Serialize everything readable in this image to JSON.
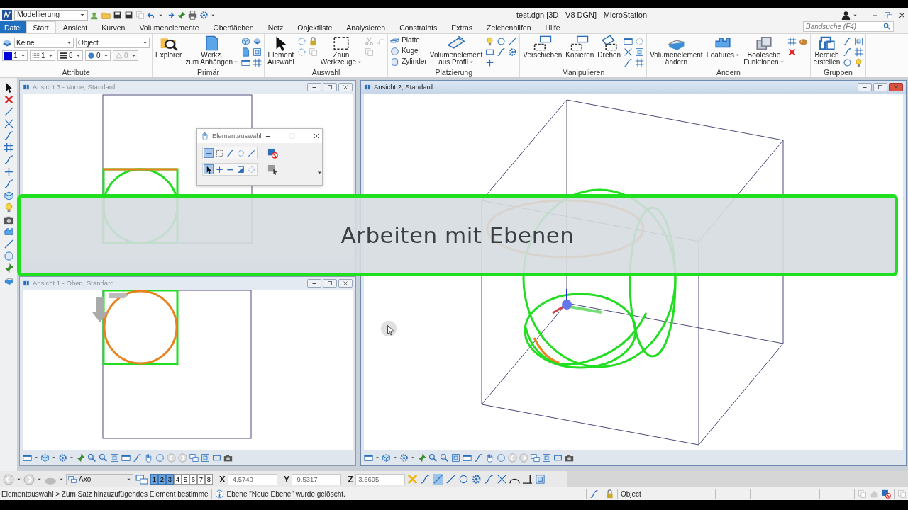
{
  "app": {
    "workflow": "Modellierung",
    "title": "test.dgn [3D - V8 DGN] - MicroStation"
  },
  "tabs": [
    {
      "label": "Datei",
      "kind": "file",
      "selected": false
    },
    {
      "label": "Start",
      "kind": "tab",
      "selected": true
    },
    {
      "label": "Ansicht",
      "kind": "tab",
      "selected": false
    },
    {
      "label": "Kurven",
      "kind": "tab",
      "selected": false
    },
    {
      "label": "Volumenelemente",
      "kind": "tab",
      "selected": false
    },
    {
      "label": "Oberflächen",
      "kind": "tab",
      "selected": false
    },
    {
      "label": "Netz",
      "kind": "tab",
      "selected": false
    },
    {
      "label": "Objektliste",
      "kind": "tab",
      "selected": false
    },
    {
      "label": "Analysieren",
      "kind": "tab",
      "selected": false
    },
    {
      "label": "Constraints",
      "kind": "tab",
      "selected": false
    },
    {
      "label": "Extras",
      "kind": "tab",
      "selected": false
    },
    {
      "label": "Zeichenhilfen",
      "kind": "tab",
      "selected": false
    },
    {
      "label": "Hilfe",
      "kind": "tab",
      "selected": false
    }
  ],
  "search": {
    "placeholder": "Bandsuche (F4)"
  },
  "attributes": {
    "label": "Attribute",
    "level": "Keine",
    "template": "Object",
    "color_index": "1",
    "line_style": "1",
    "line_weight": "8",
    "transparency": "0",
    "priority": "0",
    "priority_disabled": true
  },
  "groups": [
    {
      "label": "Primär",
      "buttons": [
        {
          "kind": "large",
          "lines": [
            "Explorer"
          ],
          "dropdown": false
        },
        {
          "kind": "large",
          "lines": [
            "Werkz.",
            "zum Anhängen"
          ],
          "dropdown": true
        },
        {
          "kind": "icons"
        }
      ]
    },
    {
      "label": "Auswahl",
      "buttons": [
        {
          "kind": "large",
          "lines": [
            "Element",
            "Auswahl"
          ],
          "dropdown": false
        },
        {
          "kind": "icons"
        },
        {
          "kind": "large",
          "lines": [
            "Zaun",
            "Werkzeuge"
          ],
          "dropdown": true
        },
        {
          "kind": "icons"
        }
      ]
    },
    {
      "label": "Platzierung",
      "buttons": [
        {
          "kind": "small",
          "lines": [
            "Platte"
          ]
        },
        {
          "kind": "small",
          "lines": [
            "Kugel"
          ]
        },
        {
          "kind": "small",
          "lines": [
            "Zylinder"
          ]
        },
        {
          "kind": "large",
          "lines": [
            "Volumenelement",
            "aus Profil"
          ],
          "dropdown": true
        },
        {
          "kind": "icons"
        }
      ]
    },
    {
      "label": "Manipulieren",
      "buttons": [
        {
          "kind": "large",
          "lines": [
            "Verschieben"
          ],
          "dropdown": false
        },
        {
          "kind": "large",
          "lines": [
            "Kopieren"
          ],
          "dropdown": false
        },
        {
          "kind": "large",
          "lines": [
            "Drehen"
          ],
          "dropdown": false
        },
        {
          "kind": "icons"
        }
      ]
    },
    {
      "label": "Ändern",
      "buttons": [
        {
          "kind": "large",
          "lines": [
            "Volumenelement",
            "ändern"
          ],
          "dropdown": false
        },
        {
          "kind": "large",
          "lines": [
            "Features"
          ],
          "dropdown": true
        },
        {
          "kind": "large",
          "lines": [
            "Boolesche",
            "Funktionen"
          ],
          "dropdown": true
        },
        {
          "kind": "icons"
        }
      ]
    },
    {
      "label": "Gruppen",
      "buttons": [
        {
          "kind": "large",
          "lines": [
            "Bereich",
            "erstellen"
          ],
          "dropdown": false
        },
        {
          "kind": "icons"
        }
      ]
    }
  ],
  "views": [
    {
      "title": "Ansicht 3 - Vorne, Standard",
      "kind": "front",
      "active": false
    },
    {
      "title": "Ansicht 1 - Oben, Standard",
      "kind": "top",
      "active": false
    },
    {
      "title": "Ansicht 2, Standard",
      "kind": "iso",
      "active": true
    }
  ],
  "selection_dialog": {
    "title": "Elementauswahl",
    "methods": [
      {
        "selected": true
      },
      {
        "selected": false
      },
      {
        "selected": false
      },
      {
        "selected": false
      },
      {
        "selected": false
      }
    ],
    "modes": [
      {
        "selected": true
      },
      {
        "selected": false
      },
      {
        "selected": false
      },
      {
        "selected": false
      },
      {
        "selected": false
      }
    ]
  },
  "overlay": {
    "text": "Arbeiten mit Ebenen"
  },
  "bottom_toolbar": {
    "view_mode": "Axo",
    "view_buttons": [
      {
        "label": "1",
        "selected": true
      },
      {
        "label": "2",
        "selected": true
      },
      {
        "label": "3",
        "selected": true
      },
      {
        "label": "4",
        "selected": false
      },
      {
        "label": "5",
        "selected": false
      },
      {
        "label": "6",
        "selected": false
      },
      {
        "label": "7",
        "selected": false
      },
      {
        "label": "8",
        "selected": false
      }
    ],
    "coordinates": [
      {
        "axis": "X",
        "value": "-4.5740"
      },
      {
        "axis": "Y",
        "value": "-9.5317"
      },
      {
        "axis": "Z",
        "value": "3.6695"
      }
    ]
  },
  "status_bar": {
    "prompt": "Elementauswahl > Zum Satz hinzuzufügendes Element bestimme",
    "message": "Ebene \"Neue Ebene\" wurde gelöscht.",
    "active_level": "Object"
  }
}
